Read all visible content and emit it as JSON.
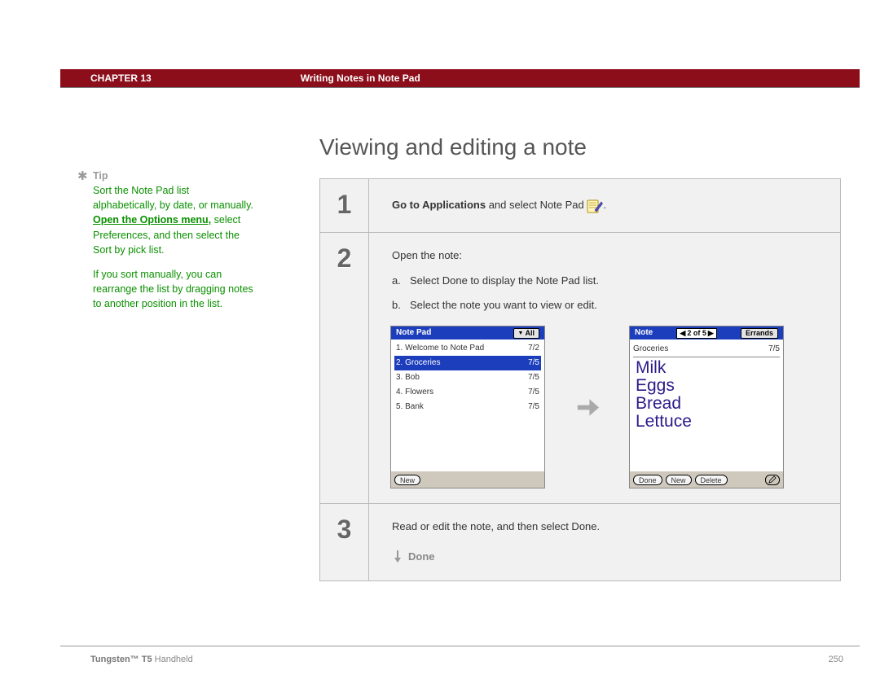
{
  "header": {
    "chapter": "CHAPTER 13",
    "title": "Writing Notes in Note Pad"
  },
  "sidebar": {
    "tip_label": "Tip",
    "p1_a": "Sort the Note Pad list alphabetically, by date, or manually. ",
    "p1_link": "Open the Options menu,",
    "p1_b": " select Preferences, and then select the Sort by pick list.",
    "p2": "If you sort manually, you can rearrange the list by dragging notes to another position in the list."
  },
  "main": {
    "heading": "Viewing and editing a note",
    "step1_num": "1",
    "step1_bold": "Go to Applications",
    "step1_rest": " and select Note Pad ",
    "step1_tail": ".",
    "step2_num": "2",
    "step2_lead": "Open the note:",
    "step2_a_letter": "a.",
    "step2_a": "Select Done to display the Note Pad list.",
    "step2_b_letter": "b.",
    "step2_b": "Select the note you want to view or edit.",
    "step3_num": "3",
    "step3_text": "Read or edit the note, and then select Done.",
    "done_label": "Done"
  },
  "palm_list": {
    "header_left": "Note Pad",
    "header_right": "All",
    "rows": [
      {
        "t": "1. Welcome to Note Pad",
        "d": "7/2"
      },
      {
        "t": "2. Groceries",
        "d": "7/5"
      },
      {
        "t": "3. Bob",
        "d": "7/5"
      },
      {
        "t": "4. Flowers",
        "d": "7/5"
      },
      {
        "t": "5. Bank",
        "d": "7/5"
      }
    ],
    "btn_new": "New"
  },
  "palm_note": {
    "header_left": "Note",
    "pager": "2 of 5",
    "header_right": "Errands",
    "row0_title": "Groceries",
    "row0_date": "7/5",
    "hand_lines": [
      "Milk",
      "Eggs",
      "Bread",
      "Lettuce"
    ],
    "btn_done": "Done",
    "btn_new": "New",
    "btn_delete": "Delete"
  },
  "footer": {
    "product_a": "Tungsten™ T5",
    "product_b": " Handheld",
    "page": "250"
  }
}
